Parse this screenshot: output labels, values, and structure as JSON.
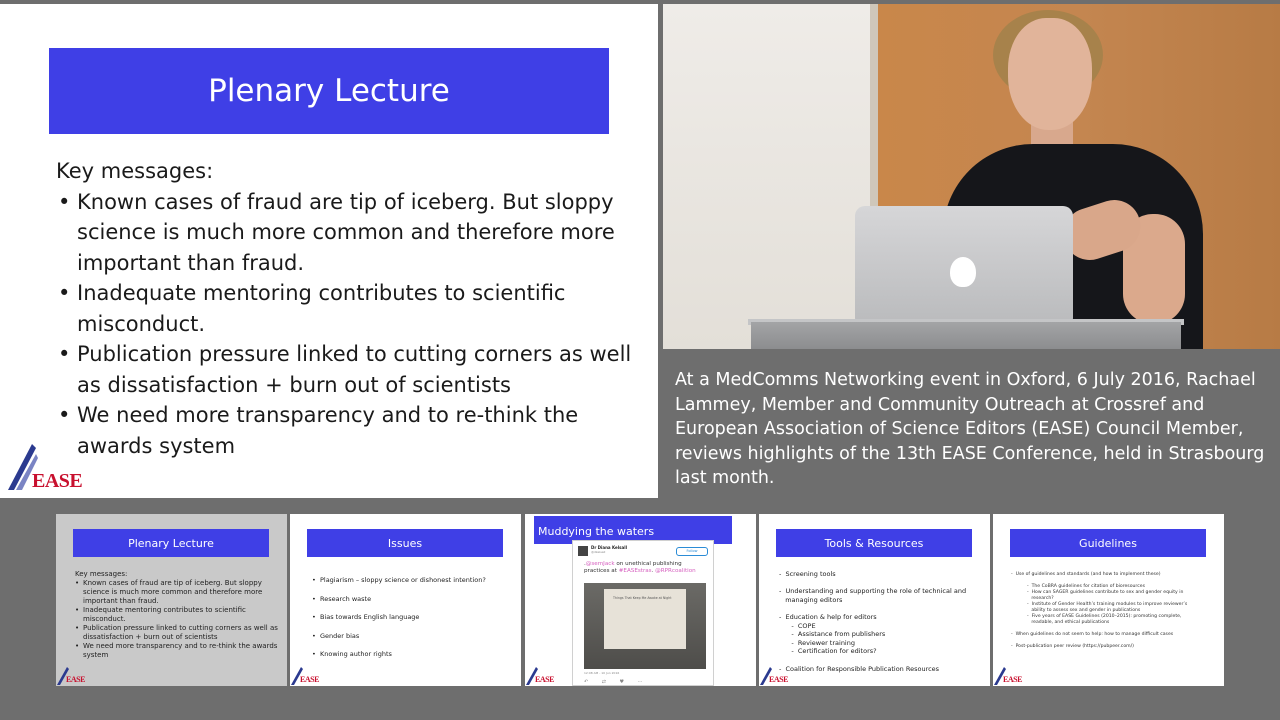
{
  "main_slide": {
    "title": "Plenary Lecture",
    "intro": "Key messages:",
    "bullets": [
      "Known cases of fraud are tip of iceberg. But sloppy science is much more common and therefore more important than fraud.",
      "Inadequate mentoring contributes to scientific misconduct.",
      "Publication pressure linked to cutting corners as well as dissatisfaction + burn out of scientists",
      "We need more transparency and to re-think the awards system"
    ],
    "logo_text": "EASE"
  },
  "caption": "At a MedComms Networking event in Oxford, 6 July 2016, Rachael Lammey, Member and Community Outreach at Crossref and European Association of Science Editors (EASE) Council Member, reviews highlights of the 13th EASE Conference, held in Strasbourg last month.",
  "thumbnails": [
    {
      "title": "Plenary Lecture",
      "intro": "Key messages:",
      "bullets": [
        "Known cases of fraud are tip of iceberg. But sloppy science is much more common and therefore more important than fraud.",
        "Inadequate mentoring contributes to scientific misconduct.",
        "Publication pressure linked to cutting corners as well as dissatisfaction + burn out of scientists",
        "We need more transparency and to re-think the awards system"
      ],
      "logo_text": "EASE"
    },
    {
      "title": "Issues",
      "items": [
        "Plagiarism – sloppy science or dishonest intention?",
        "Research waste",
        "Bias towards English language",
        "Gender bias",
        "Knowing author rights"
      ],
      "logo_text": "EASE"
    },
    {
      "title": "Muddying the waters",
      "tweet": {
        "name": "Dr Diana Kelsall",
        "handle": "@dkelsall",
        "follow": "Follow",
        "text_prefix": ".",
        "mention": "@semJack",
        "text_mid": " on unethical publishing practices at ",
        "hashtag": "#EASEstras",
        "text_end": ". ",
        "mention2": "@RPRcoalition",
        "screen_text": "Things That Keep Me Awake at Night",
        "meta": "12:08 AM - 10 Jun 2016",
        "actions": "↶ ⇄ ♥ ⋯"
      },
      "logo_text": "EASE"
    },
    {
      "title": "Tools & Resources",
      "lines": [
        "-  Screening tools",
        "",
        "-  Understanding and supporting the role of technical and",
        "   managing editors",
        "",
        "-  Education & help for editors",
        "      -  COPE",
        "      -  Assistance from publishers",
        "      -  Reviewer training",
        "      -  Certification for editors?",
        "",
        "-  Coalition for Responsible Publication Resources"
      ],
      "logo_text": "EASE"
    },
    {
      "title": "Guidelines",
      "lines": [
        "-  Use of guidelines and standards (and how to implement these)",
        "",
        "SUB:-  The CoBRA guidelines for citation of bioresources",
        "SUB:-  How can SAGER guidelines contribute to sex and gender equity in",
        "SUB:   research?",
        "SUB:-  Institute of Gender Health’s training modules to improve reviewer’s",
        "SUB:   ability to assess sex and gender in publications",
        "SUB:-  Five years of EASE Guidelines (2010–2015): promoting complete,",
        "SUB:   readable, and ethical publications",
        "",
        "-  When guidelines do not seem to help: how to manage difficult cases",
        "",
        "-  Post-publication peer review (https://pubpeer.com/)"
      ],
      "logo_text": "EASE"
    }
  ],
  "colors": {
    "title_bar": "#3f3fe6",
    "background": "#6e6e6e",
    "logo_red": "#c8102e",
    "logo_blue": "#2b3a8f"
  }
}
